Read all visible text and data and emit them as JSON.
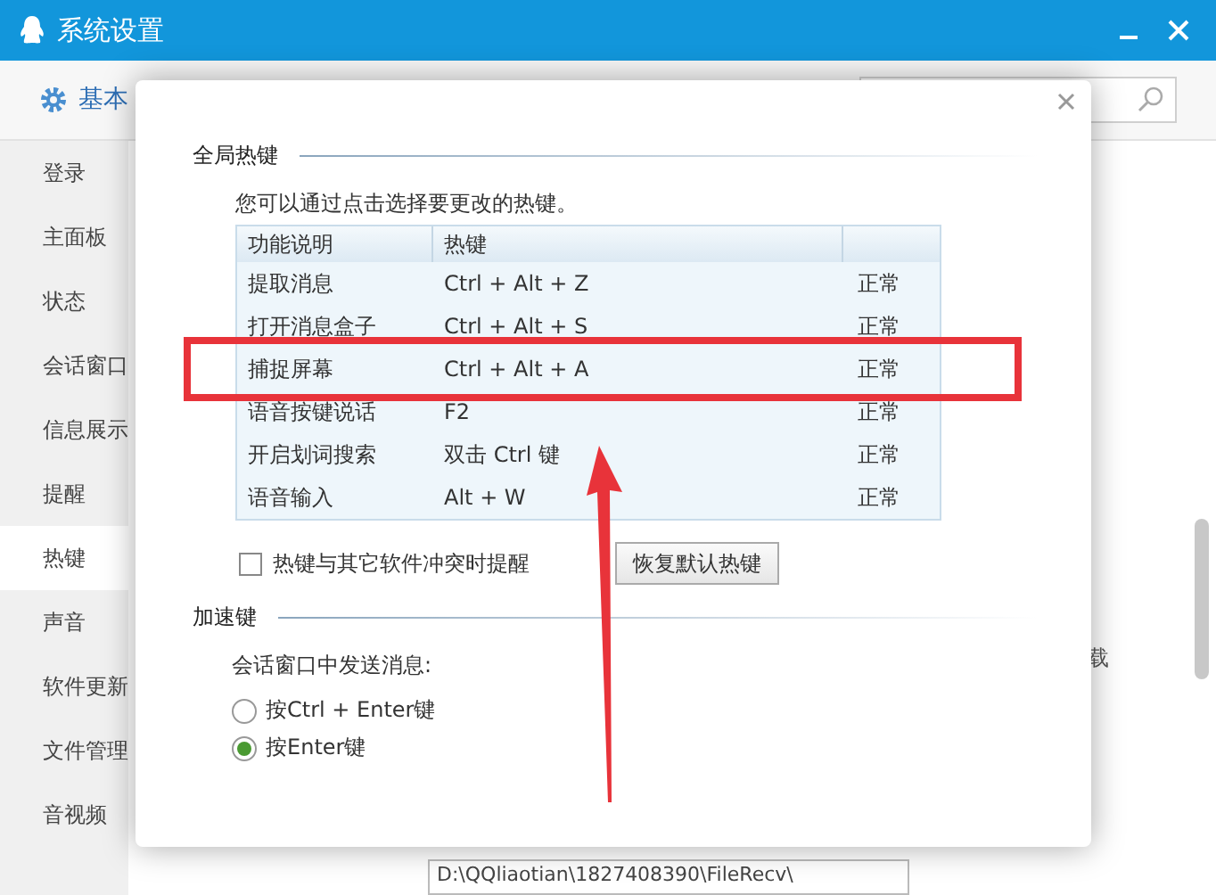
{
  "window": {
    "title": "系统设置"
  },
  "toolbar": {
    "tab": "基本"
  },
  "sidebar": {
    "items": [
      {
        "label": "登录",
        "selected": false
      },
      {
        "label": "主面板",
        "selected": false
      },
      {
        "label": "状态",
        "selected": false
      },
      {
        "label": "会话窗口",
        "selected": false
      },
      {
        "label": "信息展示",
        "selected": false
      },
      {
        "label": "提醒",
        "selected": false
      },
      {
        "label": "热键",
        "selected": true
      },
      {
        "label": "声音",
        "selected": false
      },
      {
        "label": "软件更新",
        "selected": false
      },
      {
        "label": "文件管理",
        "selected": false
      },
      {
        "label": "音视频",
        "selected": false
      }
    ]
  },
  "background": {
    "side_text": "载",
    "path_field": {
      "value": "D:\\QQliaotian\\1827408390\\FileRecv\\"
    }
  },
  "dialog": {
    "global_hotkeys": {
      "title": "全局热键",
      "hint": "您可以通过点击选择要更改的热键。",
      "table": {
        "columns": [
          "功能说明",
          "热键"
        ],
        "rows": [
          {
            "function": "提取消息",
            "hotkey": "Ctrl + Alt + Z",
            "status": "正常",
            "marked": false
          },
          {
            "function": "打开消息盒子",
            "hotkey": "Ctrl + Alt + S",
            "status": "正常",
            "marked": false
          },
          {
            "function": "捕捉屏幕",
            "hotkey": "Ctrl + Alt + A",
            "status": "正常",
            "marked": true
          },
          {
            "function": "语音按键说话",
            "hotkey": "F2",
            "status": "正常",
            "marked": false
          },
          {
            "function": "开启划词搜索",
            "hotkey": "双击 Ctrl 键",
            "status": "正常",
            "marked": false
          },
          {
            "function": "语音输入",
            "hotkey": "Alt + W",
            "status": "正常",
            "marked": false
          }
        ]
      },
      "conflict_alert": {
        "label": "热键与其它软件冲突时提醒",
        "checked": false
      },
      "restore_button": "恢复默认热键"
    },
    "accelerator": {
      "title": "加速键",
      "prompt": "会话窗口中发送消息:",
      "options": [
        {
          "label": "按Ctrl + Enter键",
          "selected": false
        },
        {
          "label": "按Enter键",
          "selected": true
        }
      ]
    }
  }
}
